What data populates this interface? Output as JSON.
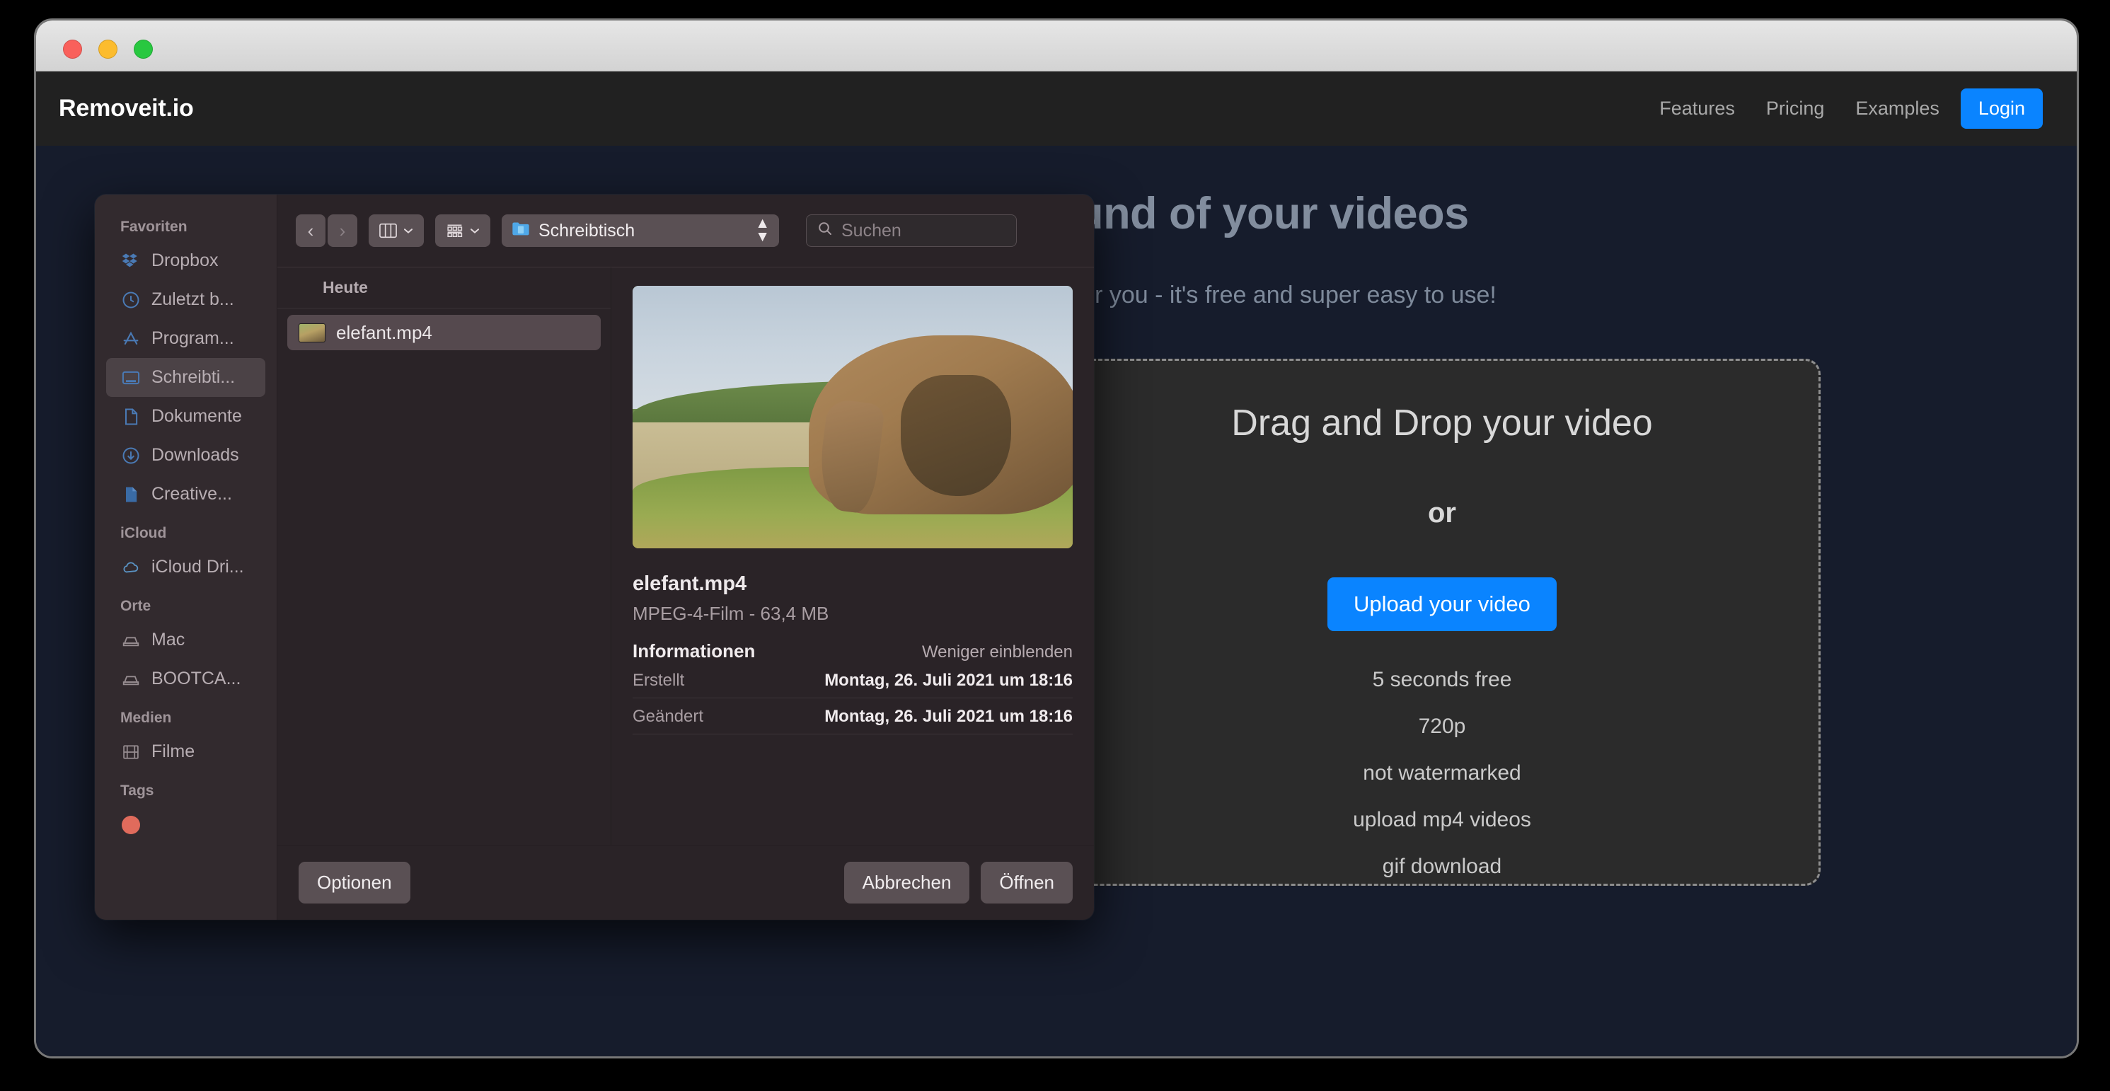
{
  "window": {
    "traffic_lights": [
      "close",
      "minimize",
      "zoom"
    ]
  },
  "site": {
    "brand": "Removeit.io",
    "nav": [
      {
        "label": "Features"
      },
      {
        "label": "Pricing"
      },
      {
        "label": "Examples"
      }
    ],
    "login_label": "Login",
    "hero": {
      "heading": "Remove the background of your videos",
      "subheading": "We remove the background of your videos for you - it's free and super easy to use!"
    },
    "dropzone": {
      "title": "Drag and Drop your video",
      "or": "or",
      "upload_label": "Upload your video",
      "features": [
        "5 seconds free",
        "720p",
        "not watermarked",
        "upload mp4 videos",
        "gif download"
      ]
    },
    "accent_color": "#0a84ff",
    "page_bg": "#161c2c",
    "header_bg": "#212121"
  },
  "finder": {
    "sidebar": {
      "groups": [
        {
          "title": "Favoriten",
          "items": [
            {
              "label": "Dropbox",
              "icon": "dropbox-icon",
              "selected": false
            },
            {
              "label": "Zuletzt b...",
              "icon": "clock-icon",
              "selected": false
            },
            {
              "label": "Program...",
              "icon": "applications-icon",
              "selected": false
            },
            {
              "label": "Schreibti...",
              "icon": "desktop-icon",
              "selected": true
            },
            {
              "label": "Dokumente",
              "icon": "document-icon",
              "selected": false
            },
            {
              "label": "Downloads",
              "icon": "download-icon",
              "selected": false
            },
            {
              "label": "Creative...",
              "icon": "file-icon",
              "selected": false
            }
          ]
        },
        {
          "title": "iCloud",
          "items": [
            {
              "label": "iCloud Dri...",
              "icon": "cloud-icon",
              "selected": false
            }
          ]
        },
        {
          "title": "Orte",
          "items": [
            {
              "label": "Mac",
              "icon": "drive-icon",
              "selected": false
            },
            {
              "label": "BOOTCA...",
              "icon": "drive-icon",
              "selected": false
            }
          ]
        },
        {
          "title": "Medien",
          "items": [
            {
              "label": "Filme",
              "icon": "film-icon",
              "selected": false
            }
          ]
        },
        {
          "title": "Tags",
          "items": []
        }
      ]
    },
    "toolbar": {
      "back_label": "‹",
      "forward_label": "›",
      "path_label": "Schreibtisch",
      "search_placeholder": "Suchen"
    },
    "file_list": {
      "group_header": "Heute",
      "rows": [
        {
          "name": "elefant.mp4"
        }
      ]
    },
    "preview": {
      "name": "elefant.mp4",
      "kind": "MPEG-4-Film - 63,4 MB",
      "info_title": "Informationen",
      "info_toggle": "Weniger einblenden",
      "info_rows": [
        {
          "key": "Erstellt",
          "value": "Montag, 26. Juli 2021 um 18:16"
        },
        {
          "key": "Geändert",
          "value": "Montag, 26. Juli 2021 um 18:16"
        }
      ]
    },
    "footer": {
      "options_label": "Optionen",
      "cancel_label": "Abbrechen",
      "open_label": "Öffnen"
    }
  }
}
